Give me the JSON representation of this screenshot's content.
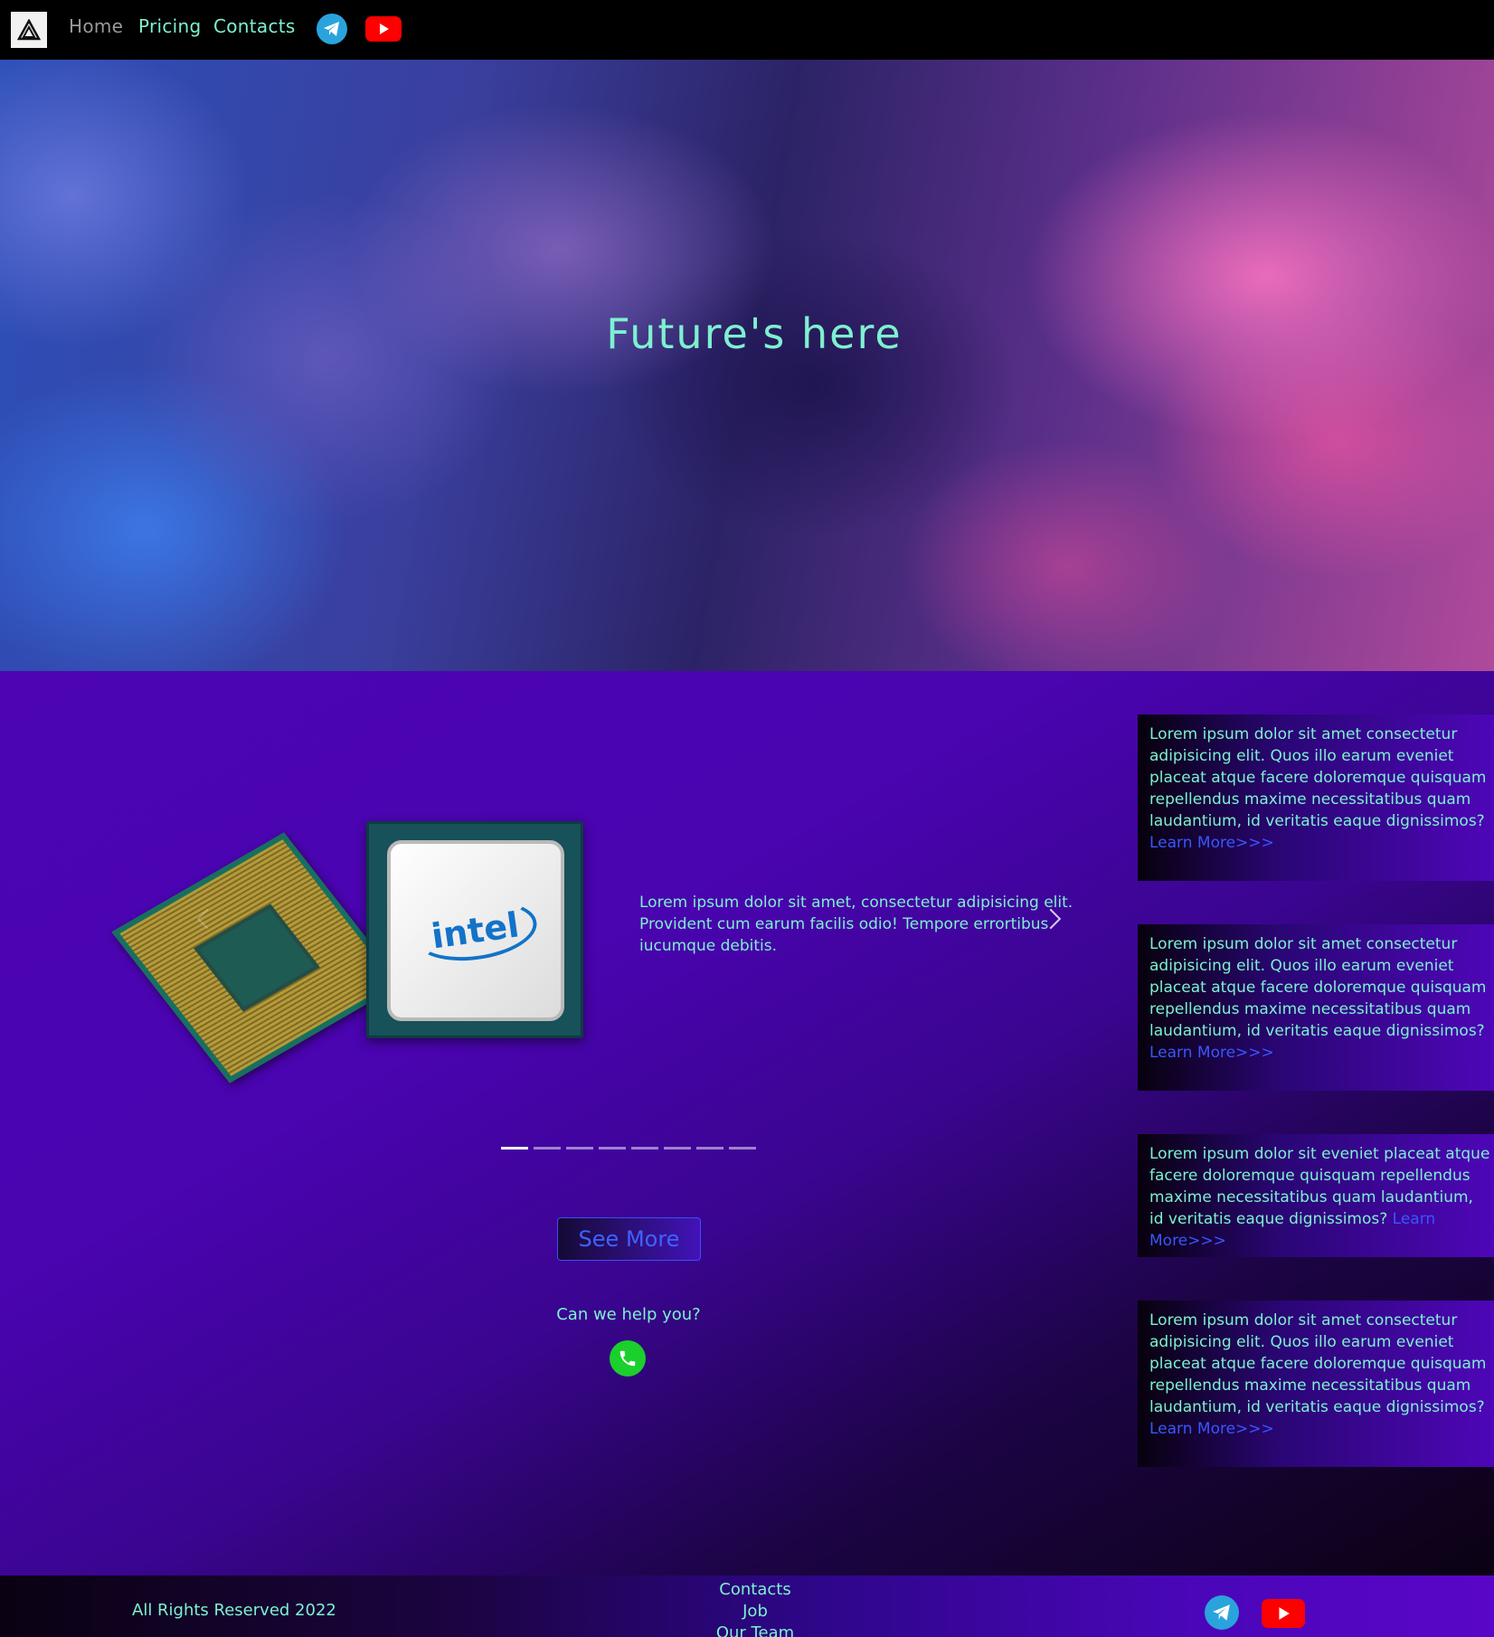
{
  "nav": {
    "logo_icon": "triangle-logo-icon",
    "links": [
      "Home",
      "Pricing",
      "Contacts"
    ],
    "telegram_icon": "telegram-icon",
    "youtube_icon": "youtube-icon"
  },
  "hero": {
    "title": "Future's here"
  },
  "slider": {
    "image_brand": "intel",
    "text": "Lorem ipsum dolor sit amet, consectetur adipisicing elit. Provident cum earum facilis odio! Tempore errortibus iucumque debitis.",
    "indicator_count": 8,
    "active_index": 0
  },
  "actions": {
    "see_more": "See More",
    "help_text": "Can we help you?",
    "phone_icon": "phone-icon"
  },
  "cards": [
    {
      "text": "Lorem ipsum dolor sit amet consectetur adipisicing elit. Quos illo earum eveniet placeat atque facere doloremque quisquam repellendus maxime necessitatibus quam laudantium, id veritatis eaque dignissimos?",
      "link": "Learn More>>>"
    },
    {
      "text": "Lorem ipsum dolor sit amet consectetur adipisicing elit. Quos illo earum eveniet placeat atque facere doloremque quisquam repellendus maxime necessitatibus quam laudantium, id veritatis eaque dignissimos?",
      "link": "Learn More>>>"
    },
    {
      "text": "Lorem ipsum dolor sit eveniet placeat atque facere doloremque quisquam repellendus maxime necessitatibus quam laudantium, id veritatis eaque dignissimos?",
      "link": "Learn More>>>"
    },
    {
      "text": "Lorem ipsum dolor sit amet consectetur adipisicing elit. Quos illo earum eveniet placeat atque facere doloremque quisquam repellendus maxime necessitatibus quam laudantium, id veritatis eaque dignissimos?",
      "link": "Learn More>>>"
    }
  ],
  "footer": {
    "rights": "All Rights Reserved 2022",
    "links": [
      "Contacts",
      "Job",
      "Our Team"
    ]
  },
  "colors": {
    "accent_text": "#7ef0d0",
    "link_blue": "#3a56ff",
    "main_purple": "#4a04b0"
  }
}
